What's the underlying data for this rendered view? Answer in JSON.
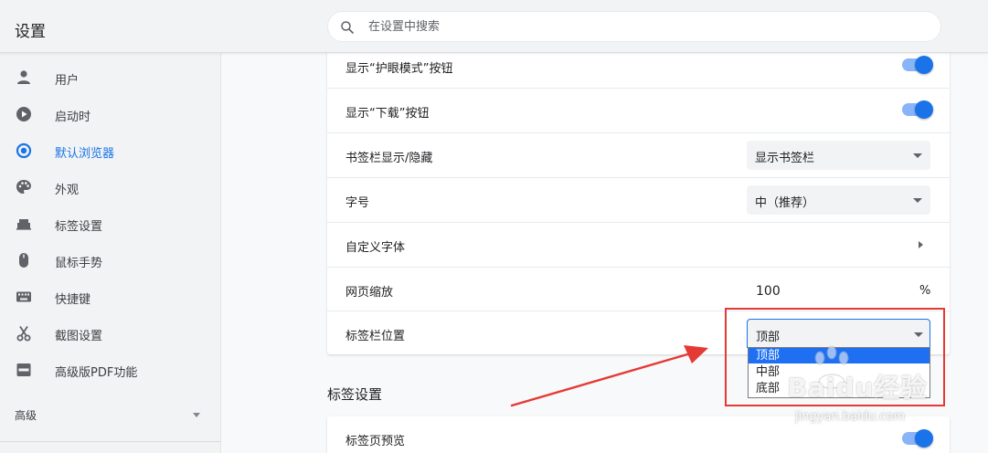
{
  "header": {
    "title": "设置",
    "search_placeholder": "在设置中搜索"
  },
  "sidebar": {
    "items": [
      {
        "label": "用户",
        "icon": "person-icon"
      },
      {
        "label": "启动时",
        "icon": "play-circle-icon"
      },
      {
        "label": "默认浏览器",
        "icon": "radio-target-icon",
        "active": true
      },
      {
        "label": "外观",
        "icon": "palette-icon"
      },
      {
        "label": "标签设置",
        "icon": "tab-icon"
      },
      {
        "label": "鼠标手势",
        "icon": "mouse-icon"
      },
      {
        "label": "快捷键",
        "icon": "keyboard-icon"
      },
      {
        "label": "截图设置",
        "icon": "scissors-icon"
      },
      {
        "label": "高级版PDF功能",
        "icon": "pdf-icon"
      }
    ],
    "advanced_label": "高级"
  },
  "appearance": {
    "rows": [
      {
        "label": "显示“护眼模式”按钮",
        "control": "toggle",
        "on": true
      },
      {
        "label": "显示“下载”按钮",
        "control": "toggle",
        "on": true
      },
      {
        "label": "书签栏显示/隐藏",
        "control": "select",
        "value": "显示书签栏"
      },
      {
        "label": "字号",
        "control": "select",
        "value": "中（推荐）"
      },
      {
        "label": "自定义字体",
        "control": "chevron"
      },
      {
        "label": "网页缩放",
        "control": "zoom",
        "value": "100",
        "unit": "%"
      },
      {
        "label": "标签栏位置",
        "control": "select",
        "value": "顶部"
      }
    ],
    "tab_position_options": [
      "顶部",
      "中部",
      "底部"
    ],
    "tab_position_selected": "顶部"
  },
  "tab_section": {
    "title": "标签设置",
    "rows": [
      {
        "label": "标签页预览",
        "control": "toggle",
        "on": true
      }
    ]
  },
  "watermark": {
    "brand": "Baidu经验",
    "url": "jingyan.baidu.com"
  },
  "colors": {
    "accent": "#1a73e8",
    "toggle_track": "#8ab4f8",
    "highlight_box": "#e53935",
    "selected_option": "#1e6ff2"
  }
}
